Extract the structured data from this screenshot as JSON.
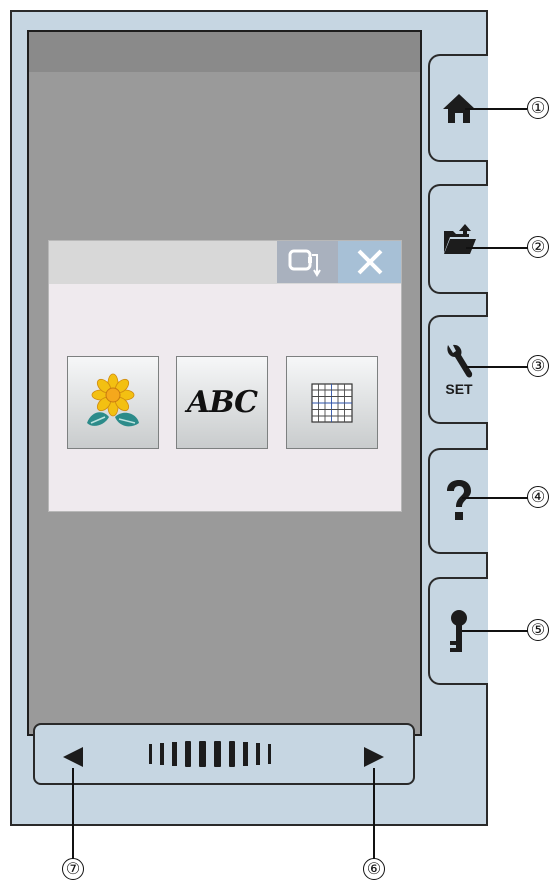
{
  "dialog": {
    "tiles": [
      {
        "icon": "flower-design-icon"
      },
      {
        "label": "ABC",
        "icon": "lettering-icon"
      },
      {
        "icon": "grid-template-icon"
      }
    ],
    "hoop_icon": "hoop-transfer-icon",
    "close_icon": "close-icon"
  },
  "side_buttons": [
    {
      "icon": "home-icon"
    },
    {
      "icon": "folder-upload-icon"
    },
    {
      "icon": "wrench-icon",
      "label": "SET"
    },
    {
      "icon": "help-question-icon"
    },
    {
      "icon": "key-icon"
    }
  ],
  "scroll": {
    "left_icon": "arrow-left-icon",
    "right_icon": "arrow-right-icon"
  },
  "callouts": [
    "①",
    "②",
    "③",
    "④",
    "⑤",
    "⑥",
    "⑦"
  ]
}
